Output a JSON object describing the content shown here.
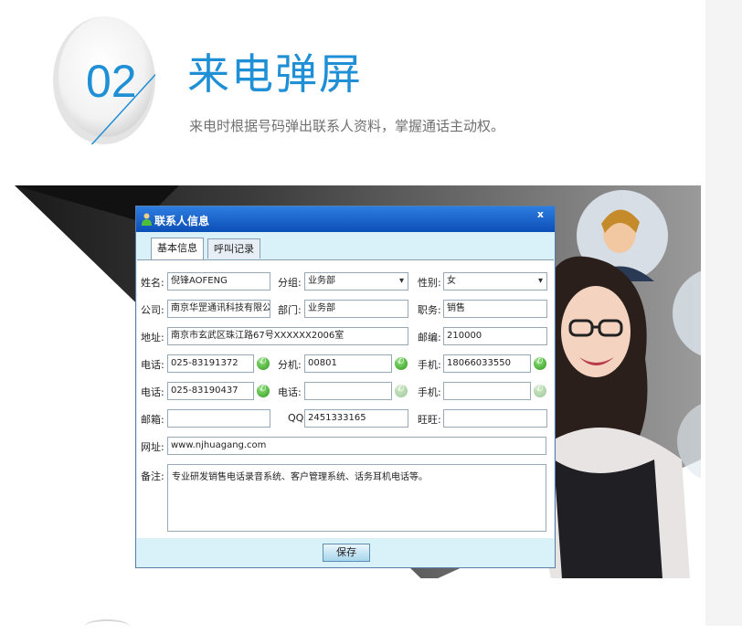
{
  "header": {
    "number": "02",
    "title": "来电弹屏",
    "subtitle": "来电时根据号码弹出联系人资料，掌握通话主动权。"
  },
  "dialog": {
    "title": "联系人信息",
    "close": "x",
    "tabs": [
      {
        "label": "基本信息",
        "active": true
      },
      {
        "label": "呼叫记录",
        "active": false
      }
    ],
    "labels": {
      "name": "姓名:",
      "group": "分组:",
      "gender": "性别:",
      "company": "公司:",
      "dept": "部门:",
      "position": "职务:",
      "address": "地址:",
      "zip": "邮编:",
      "phone1": "电话:",
      "ext": "分机:",
      "mobile1": "手机:",
      "phone2": "电话:",
      "phone3": "电话:",
      "mobile2": "手机:",
      "email": "邮箱:",
      "qq": "QQ:",
      "wangwang": "旺旺:",
      "website": "网址:",
      "note": "备注:"
    },
    "values": {
      "name": "倪锋AOFENG",
      "group": "业务部",
      "gender": "女",
      "company": "南京华罡通讯科技有限公司",
      "dept": "业务部",
      "position": "销售",
      "address": "南京市玄武区珠江路67号XXXXXX2006室",
      "zip": "210000",
      "phone1": "025-83191372",
      "ext": "00801",
      "mobile1": "18066033550",
      "phone2": "025-83190437",
      "phone3": "",
      "mobile2": "",
      "email": "",
      "qq": "2451333165",
      "wangwang": "",
      "website": "www.njhuagang.com",
      "note": "专业研发销售电话录音系统、客户管理系统、话务耳机电话等。"
    },
    "save_label": "保存"
  },
  "colors": {
    "accent": "#1f8fd6",
    "titlebar": "#0c4fb6",
    "dialog_bg": "#d9f1f9",
    "call_active": "#2f9a1e"
  },
  "icons": {
    "badge": "circle-badge-icon",
    "title": "person-icon",
    "call": "phone-call-icon"
  }
}
